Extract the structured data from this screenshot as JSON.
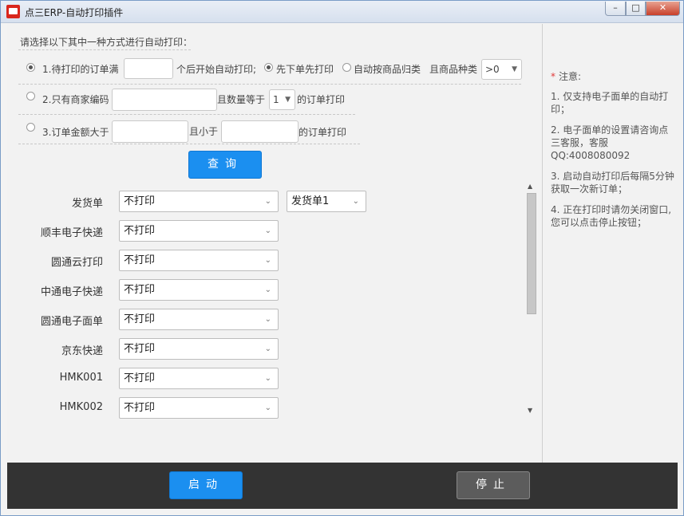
{
  "window": {
    "title": "点三ERP-自动打印插件",
    "controls": {
      "minimize": "–",
      "maximize": "□",
      "close": "✕"
    }
  },
  "options": {
    "instruction": "请选择以下其中一种方式进行自动打印：",
    "opt1": {
      "label": "1.待打印的订单满",
      "count_value": "",
      "suffix": "个后开始自动打印;",
      "sort_first": "先下单先打印",
      "sort_group": "自动按商品归类",
      "kind_label": "且商品种类",
      "kind_value": ">0",
      "selected": true,
      "sort_first_selected": true
    },
    "opt2": {
      "label": "2.只有商家编码",
      "code_value": "",
      "qty_label": "且数量等于",
      "qty_value": "1",
      "suffix": "的订单打印"
    },
    "opt3": {
      "label": "3.订单金额大于",
      "min_value": "",
      "and_less": "且小于",
      "max_value": "",
      "suffix": "的订单打印"
    },
    "query_button": "查询"
  },
  "printers": [
    {
      "label": "发货单",
      "value": "不打印",
      "extra": "发货单1"
    },
    {
      "label": "顺丰电子快递",
      "value": "不打印"
    },
    {
      "label": "圆通云打印",
      "value": "不打印"
    },
    {
      "label": "中通电子快递",
      "value": "不打印"
    },
    {
      "label": "圆通电子面单",
      "value": "不打印"
    },
    {
      "label": "京东快递",
      "value": "不打印"
    },
    {
      "label": "HMK001",
      "value": "不打印"
    },
    {
      "label": "HMK002",
      "value": "不打印"
    }
  ],
  "notes": {
    "title": "注意:",
    "items": [
      "1. 仅支持电子面单的自动打印；",
      "2. 电子面单的设置请咨询点三客服，客服QQ:4008080092",
      "3. 启动自动打印后每隔5分钟获取一次新订单；",
      "4. 正在打印时请勿关闭窗口,您可以点击停止按钮；"
    ]
  },
  "footer": {
    "start_button": "启动",
    "stop_button": "停止"
  },
  "colors": {
    "primary": "#1b8ff0",
    "footer_bg": "#333333",
    "stop_bg": "#5c5c5c",
    "required_star": "#e03a3a"
  }
}
